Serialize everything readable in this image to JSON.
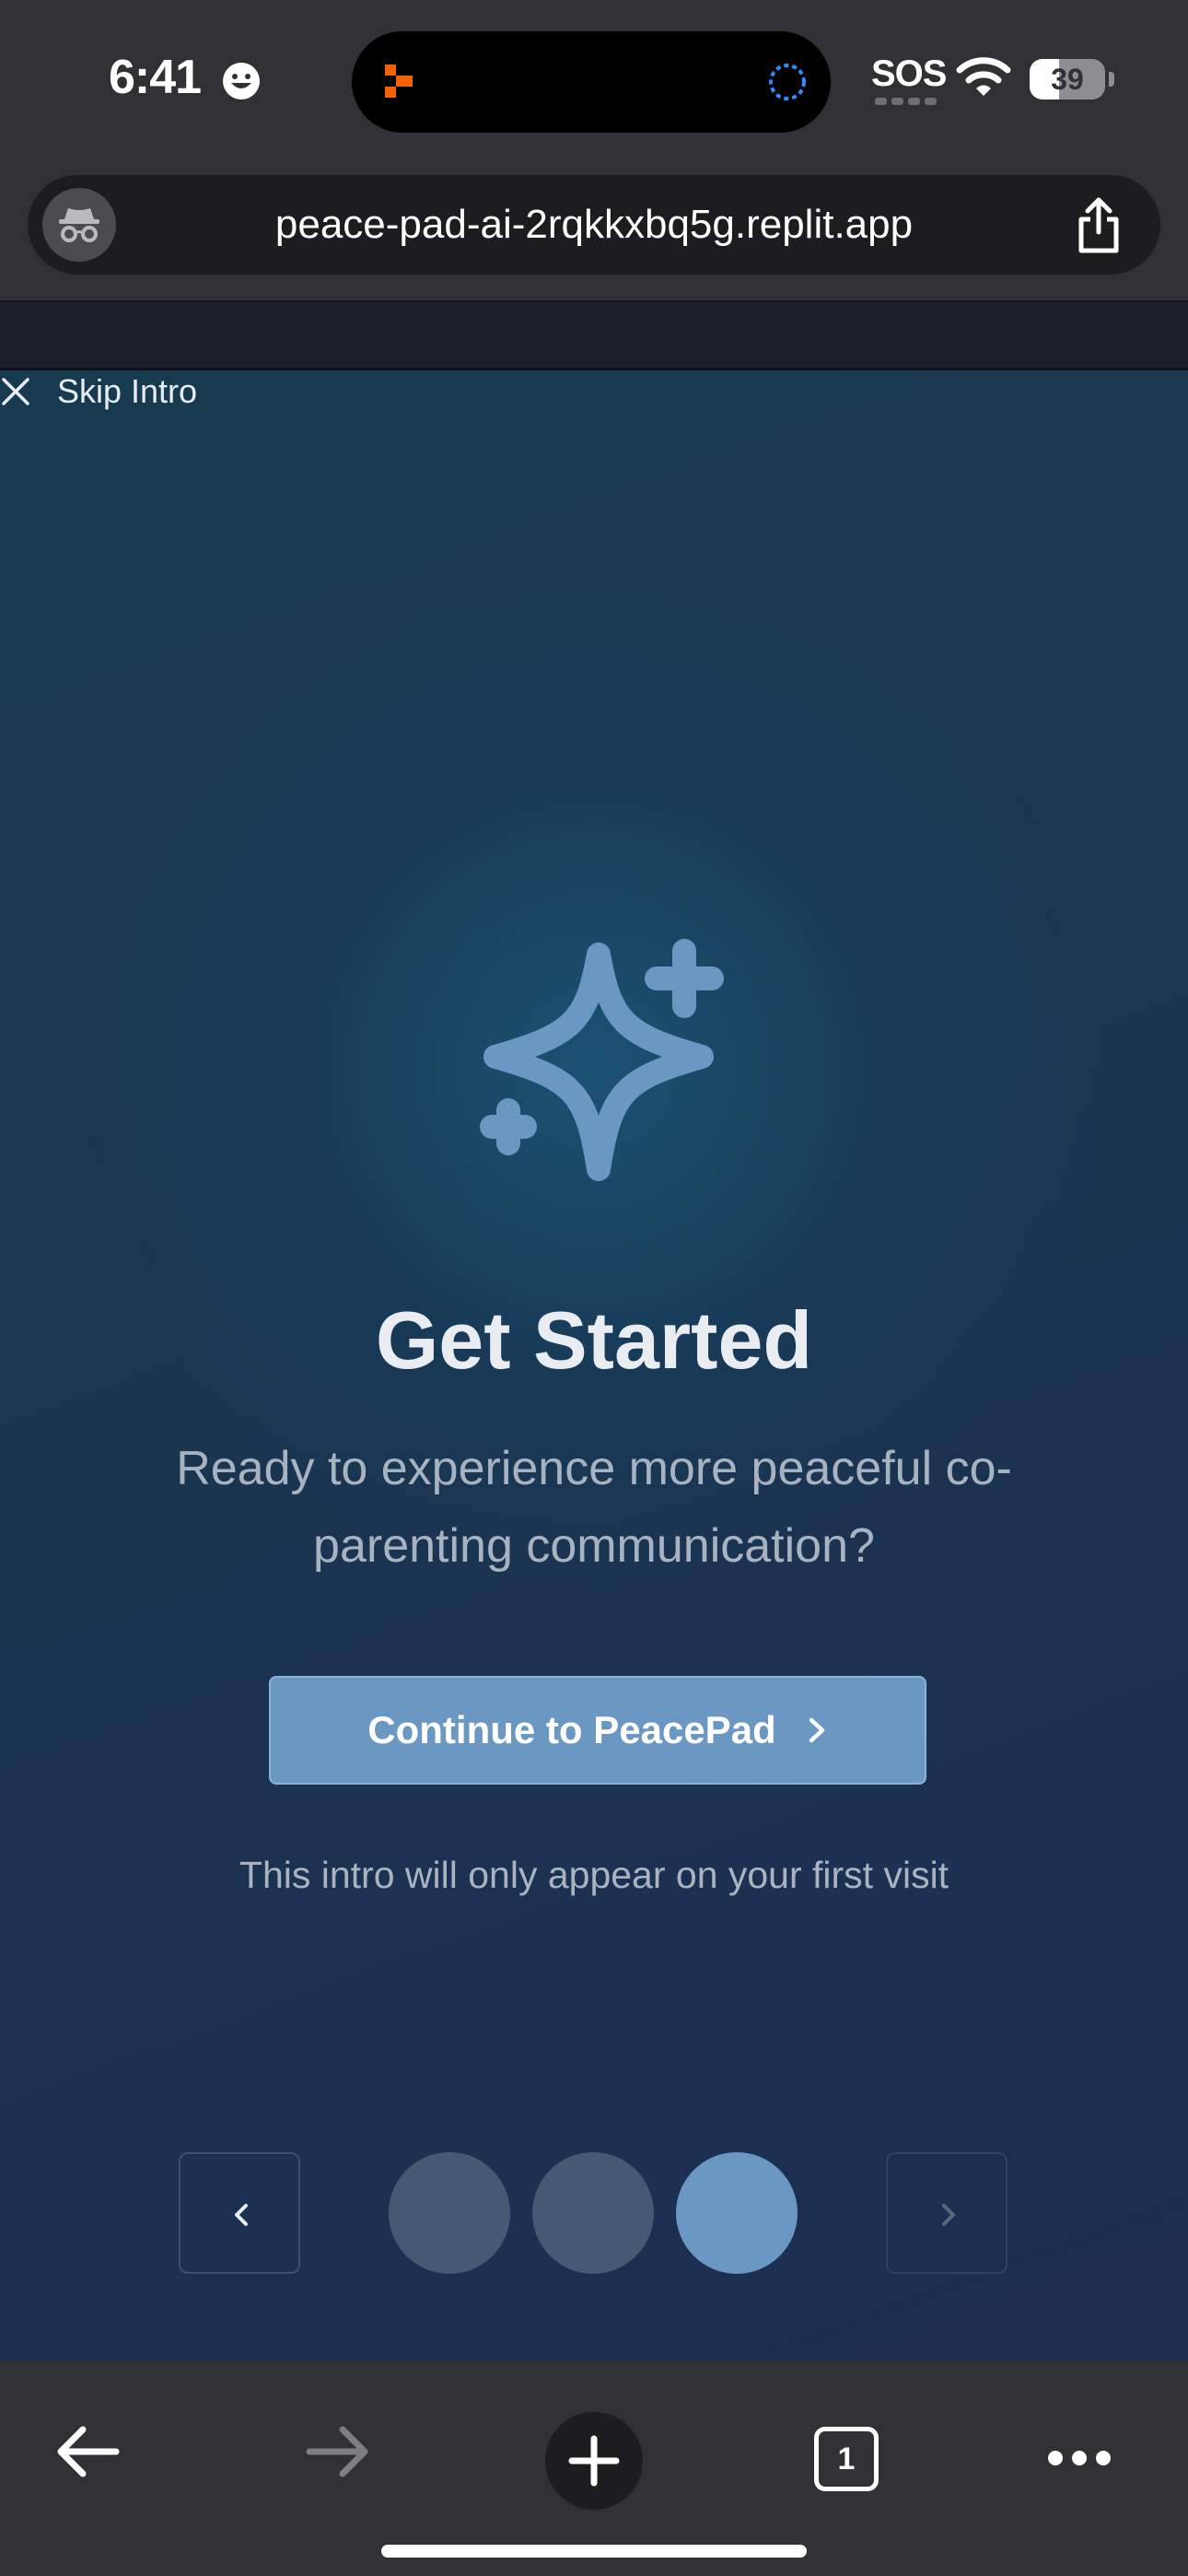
{
  "status_bar": {
    "time": "6:41",
    "sos": "SOS",
    "battery_level": "39",
    "battery_fraction": 0.39,
    "icons": [
      "smiley-icon",
      "recording-app-icon",
      "activity-ring-icon",
      "wifi-icon",
      "battery-icon"
    ]
  },
  "address_bar": {
    "url": "peace-pad-ai-2rqkkxbq5g.replit.app",
    "icons": [
      "incognito-icon",
      "share-icon"
    ]
  },
  "intro": {
    "skip_label": "Skip Intro",
    "title": "Get Started",
    "subtitle": "Ready to experience more peaceful co-parenting communication?",
    "cta_label": "Continue to PeacePad",
    "note": "This intro will only appear on your first visit",
    "current_step": 3,
    "total_steps": 3,
    "icons": [
      "close-icon",
      "sparkle-icon",
      "chevron-right-icon",
      "chevron-left-icon"
    ]
  },
  "toolbar": {
    "tab_count": "1",
    "icons": [
      "back-arrow-icon",
      "forward-arrow-icon",
      "plus-icon",
      "tabs-icon",
      "more-icon"
    ]
  },
  "colors": {
    "accent": "#6b97c3",
    "dot_inactive": "#445a74",
    "background": "#1a3650",
    "chrome": "#2f3134"
  }
}
